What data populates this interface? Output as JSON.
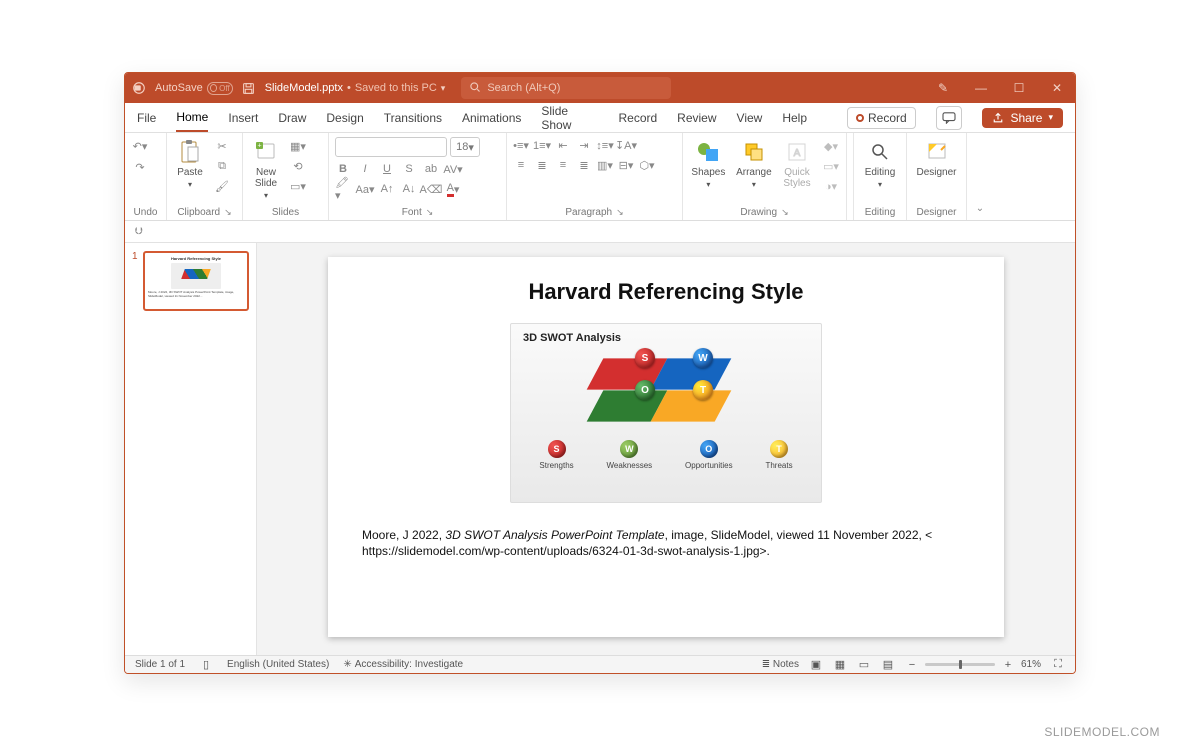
{
  "titlebar": {
    "autosave_label": "AutoSave",
    "autosave_state": "Off",
    "docname": "SlideModel.pptx",
    "saved_text": "Saved to this PC",
    "search_placeholder": "Search (Alt+Q)"
  },
  "menu": {
    "items": [
      "File",
      "Home",
      "Insert",
      "Draw",
      "Design",
      "Transitions",
      "Animations",
      "Slide Show",
      "Record",
      "Review",
      "View",
      "Help"
    ],
    "active": "Home",
    "record_btn": "Record",
    "share_btn": "Share"
  },
  "ribbon": {
    "undo": {
      "label": "Undo"
    },
    "clipboard": {
      "paste": "Paste",
      "label": "Clipboard"
    },
    "slides": {
      "newslide": "New\nSlide",
      "label": "Slides"
    },
    "font": {
      "size": "18",
      "label": "Font"
    },
    "paragraph": {
      "label": "Paragraph"
    },
    "drawing": {
      "shapes": "Shapes",
      "arrange": "Arrange",
      "quick": "Quick\nStyles",
      "label": "Drawing"
    },
    "editing": {
      "label": "Editing",
      "btn": "Editing"
    },
    "designer": {
      "label": "Designer",
      "btn": "Designer"
    }
  },
  "thumbs": {
    "num": "1"
  },
  "slide": {
    "title": "Harvard Referencing Style",
    "swot_title": "3D SWOT Analysis",
    "balls": {
      "s": "S",
      "w": "W",
      "o": "O",
      "t": "T"
    },
    "legend": {
      "s": {
        "letter": "S",
        "label": "Strengths"
      },
      "w": {
        "letter": "W",
        "label": "Weaknesses"
      },
      "o": {
        "letter": "O",
        "label": "Opportunities"
      },
      "t": {
        "letter": "T",
        "label": "Threats"
      }
    },
    "citation_pre": "Moore, J 2022, ",
    "citation_title": "3D SWOT Analysis PowerPoint Template",
    "citation_post": ", image, SlideModel, viewed 11 November 2022, < https://slidemodel.com/wp-content/uploads/6324-01-3d-swot-analysis-1.jpg>."
  },
  "status": {
    "slide_of": "Slide 1 of 1",
    "lang": "English (United States)",
    "access": "Accessibility: Investigate",
    "notes": "Notes",
    "zoom": "61%"
  },
  "watermark": "SLIDEMODEL.COM"
}
